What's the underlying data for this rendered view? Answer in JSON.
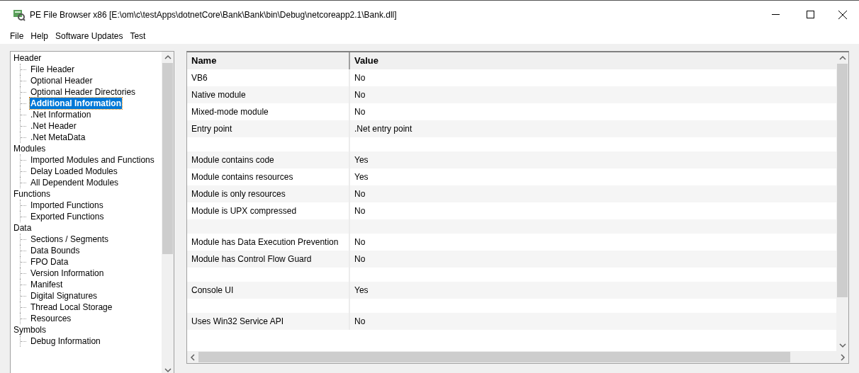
{
  "window": {
    "title": "PE File Browser x86 [E:\\om\\c\\testApps\\dotnetCore\\Bank\\Bank\\bin\\Debug\\netcoreapp2.1\\Bank.dll]"
  },
  "menu": [
    "File",
    "Help",
    "Software Updates",
    "Test"
  ],
  "tree": [
    {
      "label": "Header",
      "selected": false,
      "children": [
        {
          "label": "File Header",
          "selected": false
        },
        {
          "label": "Optional Header",
          "selected": false
        },
        {
          "label": "Optional Header Directories",
          "selected": false
        },
        {
          "label": "Additional Information",
          "selected": true
        },
        {
          "label": ".Net Information",
          "selected": false
        },
        {
          "label": ".Net Header",
          "selected": false
        },
        {
          "label": ".Net MetaData",
          "selected": false
        }
      ]
    },
    {
      "label": "Modules",
      "selected": false,
      "children": [
        {
          "label": "Imported Modules and Functions",
          "selected": false
        },
        {
          "label": "Delay Loaded Modules",
          "selected": false
        },
        {
          "label": "All Dependent Modules",
          "selected": false
        }
      ]
    },
    {
      "label": "Functions",
      "selected": false,
      "children": [
        {
          "label": "Imported Functions",
          "selected": false
        },
        {
          "label": "Exported Functions",
          "selected": false
        }
      ]
    },
    {
      "label": "Data",
      "selected": false,
      "children": [
        {
          "label": "Sections / Segments",
          "selected": false
        },
        {
          "label": "Data Bounds",
          "selected": false
        },
        {
          "label": "FPO Data",
          "selected": false
        },
        {
          "label": "Version Information",
          "selected": false
        },
        {
          "label": "Manifest",
          "selected": false
        },
        {
          "label": "Digital Signatures",
          "selected": false
        },
        {
          "label": "Thread Local Storage",
          "selected": false
        },
        {
          "label": "Resources",
          "selected": false
        }
      ]
    },
    {
      "label": "Symbols",
      "selected": false,
      "children": [
        {
          "label": "Debug Information",
          "selected": false
        }
      ]
    }
  ],
  "table": {
    "columns": [
      "Name",
      "Value"
    ],
    "rows": [
      [
        "VB6",
        "No"
      ],
      [
        "Native module",
        "No"
      ],
      [
        "Mixed-mode module",
        "No"
      ],
      [
        "Entry point",
        ".Net entry point"
      ],
      [],
      [
        "Module contains code",
        "Yes"
      ],
      [
        "Module contains resources",
        "Yes"
      ],
      [
        "Module is only resources",
        "No"
      ],
      [
        "Module is UPX compressed",
        "No"
      ],
      [],
      [
        "Module has Data Execution Prevention",
        "No"
      ],
      [
        "Module has Control Flow Guard",
        "No"
      ],
      [],
      [
        "Console UI",
        "Yes"
      ],
      [],
      [
        "Uses Win32 Service API",
        "No"
      ]
    ]
  }
}
